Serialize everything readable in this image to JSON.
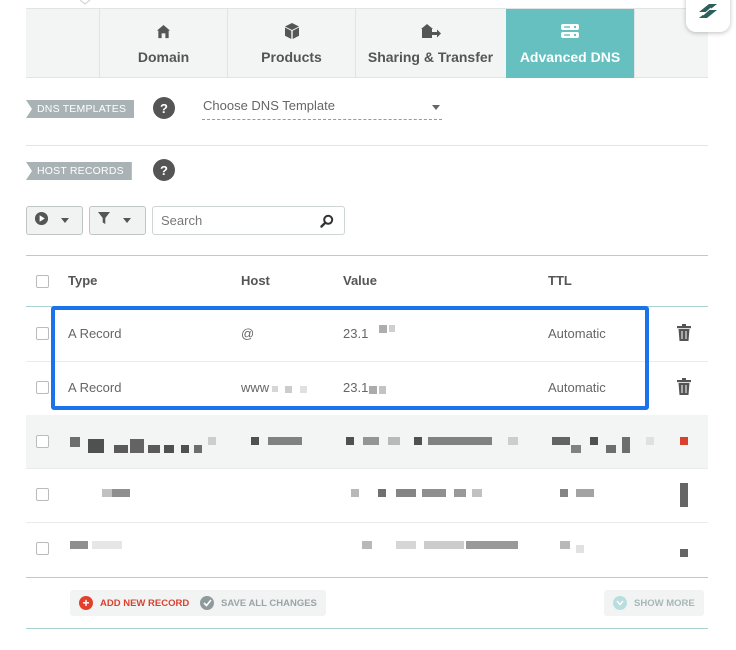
{
  "tabs": [
    {
      "label": "Domain",
      "icon": "home-icon",
      "active": false
    },
    {
      "label": "Products",
      "icon": "box-icon",
      "active": false
    },
    {
      "label": "Sharing & Transfer",
      "icon": "house-arrow-icon",
      "active": false
    },
    {
      "label": "Advanced DNS",
      "icon": "server-icon",
      "active": true
    }
  ],
  "dns_templates": {
    "label": "DNS TEMPLATES",
    "help": "?",
    "select_value": "Choose DNS Template"
  },
  "host_records": {
    "label": "HOST RECORDS",
    "help": "?"
  },
  "toolbar": {
    "search_placeholder": "Search"
  },
  "table": {
    "headers": {
      "type": "Type",
      "host": "Host",
      "value": "Value",
      "ttl": "TTL"
    },
    "rows": [
      {
        "type": "A Record",
        "host": "@",
        "value": "23.1",
        "ttl": "Automatic"
      },
      {
        "type": "A Record",
        "host": "www",
        "value": "23.1",
        "ttl": "Automatic"
      }
    ]
  },
  "footer": {
    "add_label": "ADD NEW RECORD",
    "save_label": "SAVE ALL CHANGES",
    "show_more_label": "SHOW MORE"
  },
  "colors": {
    "accent_teal": "#66c0bf",
    "highlight_blue": "#1a73e8",
    "add_red": "#e2402c",
    "delete_red": "#d9412f"
  }
}
